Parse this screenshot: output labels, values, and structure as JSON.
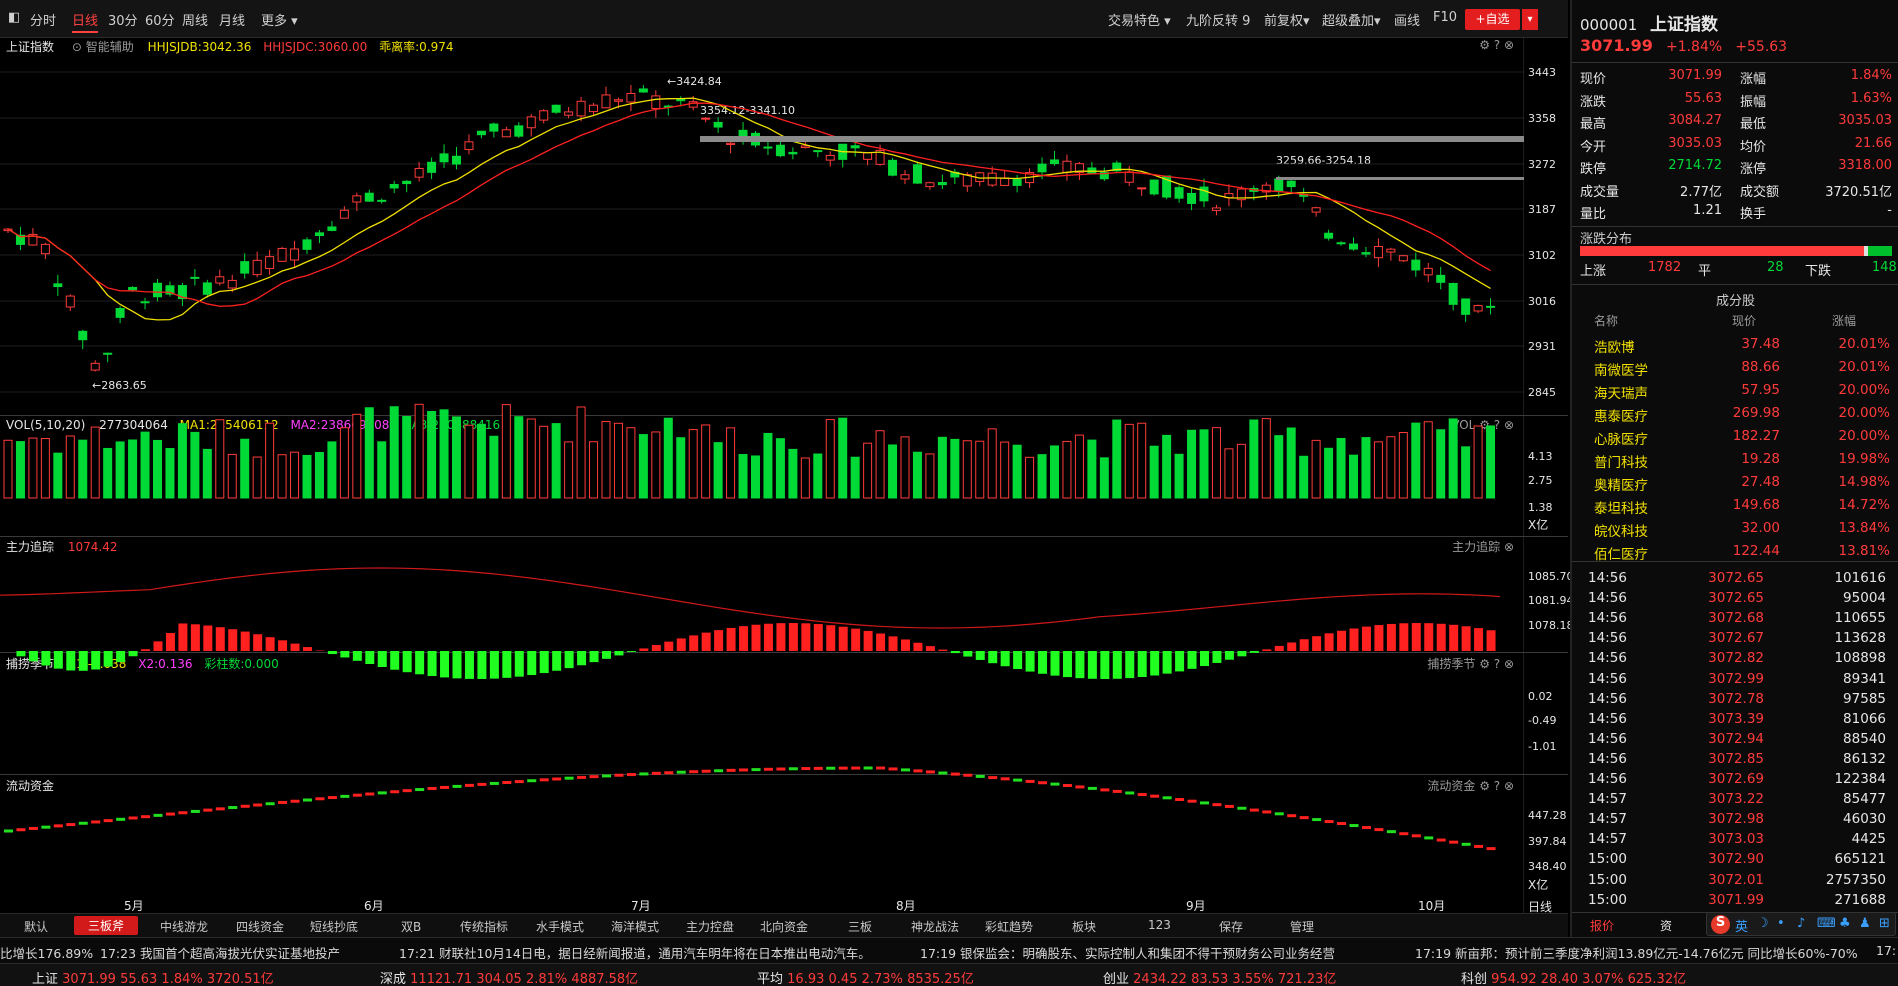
{
  "toolbar": {
    "left_tabs": [
      "分时",
      "日线",
      "30分",
      "60分",
      "周线",
      "月线",
      "更多 ▾"
    ],
    "right_items": [
      "交易特色 ▾",
      "九阶反转 9",
      "前复权▾",
      "超级叠加▾",
      "画线",
      "F10"
    ],
    "add_watch": "+自选",
    "drop": "▾"
  },
  "main_legend": {
    "name": "上证指数",
    "assist": "智能辅助",
    "hhjsjdb": "HHJSJDB:3042.36",
    "hhjsjdc": "HHJSJDC:3060.00",
    "deviation": "乖离率:0.974"
  },
  "price_axis": [
    "3443",
    "3358",
    "3272",
    "3187",
    "3102",
    "3016",
    "2931",
    "2845"
  ],
  "annotations": {
    "high": "3424.84",
    "low": "2863.65",
    "zone1": "3354.12-3341.10",
    "zone2": "3259.66-3254.18"
  },
  "vol_legend": {
    "label": "VOL(5,10,20)",
    "value": "277304064",
    "ma1": "MA1:245406112",
    "ma2": "MA2:238669008",
    "ma3": "MA3:250488416",
    "tag": "VOL"
  },
  "vol_axis": [
    "4.13",
    "2.75",
    "1.38"
  ],
  "vol_unit": "X亿",
  "main_force": {
    "label": "主力追踪",
    "value": "1074.42",
    "tag": "主力追踪",
    "axis": [
      "1085.70",
      "1081.94",
      "1078.18"
    ]
  },
  "season": {
    "label": "捕捞季节",
    "x1": "X1:-0.038",
    "x2": "X2:0.136",
    "bars": "彩柱数:0.000",
    "tag": "捕捞季节",
    "axis": [
      "0.02",
      "-0.49",
      "-1.01"
    ]
  },
  "flow": {
    "label": "流动资金",
    "tag": "流动资金",
    "axis": [
      "447.28",
      "397.84",
      "348.40"
    ],
    "unit": "X亿"
  },
  "months": [
    "5月",
    "6月",
    "7月",
    "8月",
    "9月",
    "10月"
  ],
  "period_label": "日线",
  "bottom_tabs": [
    "默认",
    "三板斧",
    "中线游龙",
    "四线资金",
    "短线抄底",
    "双B",
    "传统指标",
    "水手模式",
    "海洋模式",
    "主力控盘",
    "北向资金",
    "三板",
    "神龙战法",
    "彩虹趋势",
    "板块",
    "123",
    "保存",
    "管理"
  ],
  "news": [
    "比增长176.89%",
    "17:23 我国首个超高海拔光伏实证基地投产",
    "17:21 财联社10月14日电，据日经新闻报道，通用汽车明年将在日本推出电动汽车。",
    "17:19 银保监会：明确股东、实际控制人和集团不得干预财务公司业务经营",
    "17:19 新亩邦：预计前三季度净利润13.89亿元-14.76亿元 同比增长60%-70%",
    "17:"
  ],
  "index_bar": [
    {
      "name": "上证",
      "price": "3071.99",
      "chg": "55.63",
      "pct": "1.84%",
      "amt": "3720.51亿"
    },
    {
      "name": "深成",
      "price": "11121.71",
      "chg": "304.05",
      "pct": "2.81%",
      "amt": "4887.58亿"
    },
    {
      "name": "平均",
      "price": "16.93",
      "chg": "0.45",
      "pct": "2.73%",
      "amt": "8535.25亿"
    },
    {
      "name": "创业",
      "price": "2434.22",
      "chg": "83.53",
      "pct": "3.55%",
      "amt": "721.23亿"
    },
    {
      "name": "科创",
      "price": "954.92",
      "chg": "28.40",
      "pct": "3.07%",
      "amt": "625.32亿"
    }
  ],
  "quote": {
    "code": "000001",
    "name": "上证指数",
    "price": "3071.99",
    "pct": "+1.84%",
    "chg": "+55.63",
    "rows": [
      [
        "现价",
        "3071.99",
        "涨幅",
        "1.84%"
      ],
      [
        "涨跌",
        "55.63",
        "振幅",
        "1.63%"
      ],
      [
        "最高",
        "3084.27",
        "最低",
        "3035.03"
      ],
      [
        "今开",
        "3035.03",
        "均价",
        "21.66"
      ],
      [
        "跌停",
        "2714.72",
        "涨停",
        "3318.00"
      ],
      [
        "成交量",
        "2.77亿",
        "成交额",
        "3720.51亿"
      ],
      [
        "量比",
        "1.21",
        "换手",
        "-"
      ]
    ],
    "dist_title": "涨跌分布",
    "up_label": "上涨",
    "up": "1782",
    "flat_label": "平",
    "flat": "28",
    "down_label": "下跌",
    "down": "148"
  },
  "constituents": {
    "title": "成分股",
    "headers": [
      "名称",
      "现价",
      "涨幅"
    ],
    "rows": [
      [
        "浩欧博",
        "37.48",
        "20.01%"
      ],
      [
        "南微医学",
        "88.66",
        "20.01%"
      ],
      [
        "海天瑞声",
        "57.95",
        "20.00%"
      ],
      [
        "惠泰医疗",
        "269.98",
        "20.00%"
      ],
      [
        "心脉医疗",
        "182.27",
        "20.00%"
      ],
      [
        "普门科技",
        "19.28",
        "19.98%"
      ],
      [
        "奥精医疗",
        "27.48",
        "14.98%"
      ],
      [
        "泰坦科技",
        "149.68",
        "14.72%"
      ],
      [
        "皖仪科技",
        "32.00",
        "13.84%"
      ],
      [
        "佰仁医疗",
        "122.44",
        "13.81%"
      ]
    ]
  },
  "ticks": [
    [
      "14:56",
      "3072.65",
      "101616"
    ],
    [
      "14:56",
      "3072.65",
      "95004"
    ],
    [
      "14:56",
      "3072.68",
      "110655"
    ],
    [
      "14:56",
      "3072.67",
      "113628"
    ],
    [
      "14:56",
      "3072.82",
      "108898"
    ],
    [
      "14:56",
      "3072.99",
      "89341"
    ],
    [
      "14:56",
      "3072.78",
      "97585"
    ],
    [
      "14:56",
      "3073.39",
      "81066"
    ],
    [
      "14:56",
      "3072.94",
      "88540"
    ],
    [
      "14:56",
      "3072.85",
      "86132"
    ],
    [
      "14:56",
      "3072.69",
      "122384"
    ],
    [
      "14:57",
      "3073.22",
      "85477"
    ],
    [
      "14:57",
      "3072.98",
      "46030"
    ],
    [
      "14:57",
      "3073.03",
      "4425"
    ],
    [
      "15:00",
      "3072.90",
      "665121"
    ],
    [
      "15:00",
      "3072.01",
      "2757350"
    ],
    [
      "15:00",
      "3071.99",
      "271688"
    ]
  ],
  "rp_bottom_tabs": [
    "报价",
    "资"
  ],
  "colors": {
    "up": "#ff3b3b",
    "down": "#00d936",
    "ma_yellow": "#f0e000",
    "accent": "#e41e1e"
  }
}
